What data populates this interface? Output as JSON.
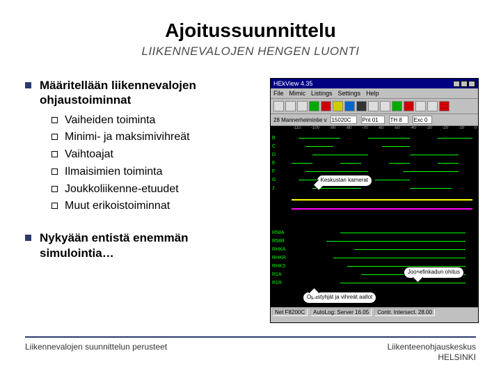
{
  "title": "Ajoitussuunnittelu",
  "subtitle": "LIIKENNEVALOJEN HENGEN LUONTI",
  "bullets": [
    {
      "text": "Määritellään liikennevalojen ohjaustoiminnat",
      "subs": [
        "Vaiheiden toiminta",
        "Minimi- ja maksimivihreät",
        "Vaihtoajat",
        "Ilmaisimien toiminta",
        "Joukkoliikenne-etuudet",
        "Muut erikoistoiminnat"
      ]
    },
    {
      "text": "Nykyään entistä enemmän simulointia…",
      "subs": []
    }
  ],
  "screenshot": {
    "window_title": "HEkView 4.35",
    "menu": [
      "File",
      "Mimic",
      "Listings",
      "Settings",
      "Help"
    ],
    "field_label": "28 Mannerheimintie v",
    "field_input1": "15020C",
    "field_input2": "Pnt 01",
    "field_input3": "TH 8",
    "field_input4": "Exc 0",
    "ruler": [
      "-110",
      "-100",
      "-90",
      "-80",
      "-70",
      "-60",
      "-50",
      "-40",
      "-30",
      "-20",
      "-10",
      "0"
    ],
    "row_labels": [
      "B",
      "C",
      "D",
      "E",
      "F",
      "G",
      "J",
      "R58A",
      "R58R",
      "RHKA",
      "RHKR",
      "RHKS",
      "R1A",
      "R1R"
    ],
    "status": [
      "Net F8200C",
      "AutoLog: Server 16.05",
      "Contr. Intersect. 28.00"
    ],
    "callouts": {
      "c1": "Keskustan kamerat",
      "c2": "Joosefinkadun ohitus",
      "c3": "Opastyhjät ja vihreät aallot"
    }
  },
  "footer": {
    "left": "Liikennevalojen suunnittelun perusteet",
    "right1": "Liikenteenohjauskeskus",
    "right2": "HELSINKI"
  }
}
